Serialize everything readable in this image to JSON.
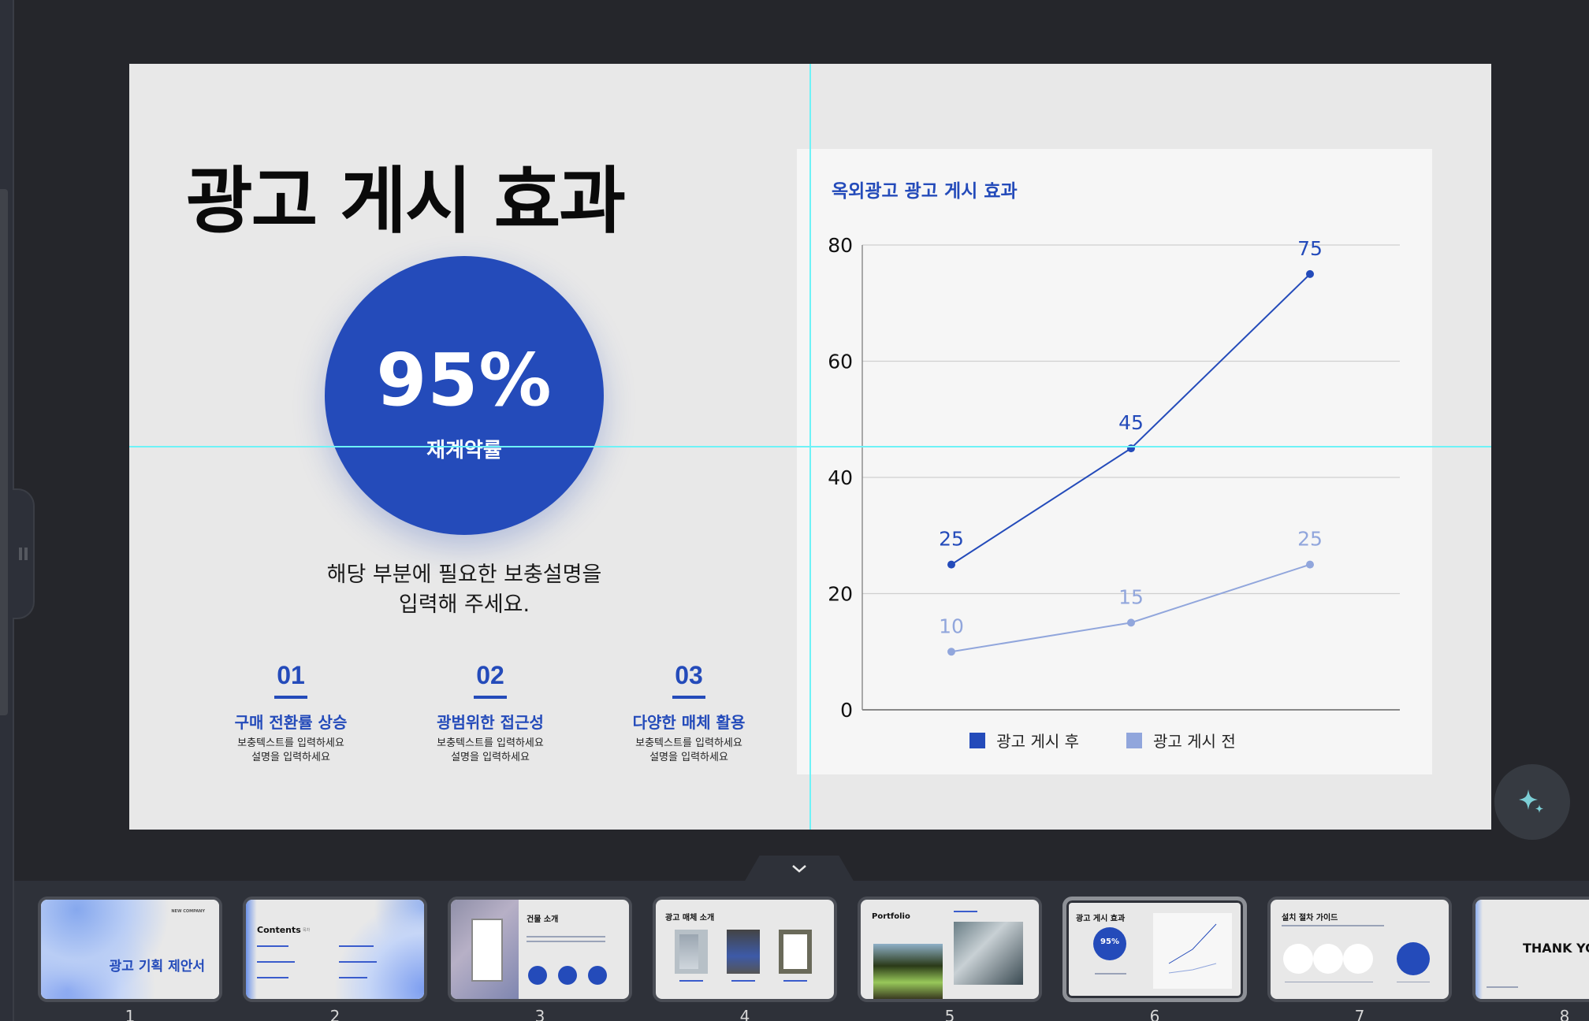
{
  "slide": {
    "title": "광고 게시 효과",
    "highlight": {
      "value": "95%",
      "label": "재계약률"
    },
    "description_lines": [
      "해당 부분에 필요한 보충설명을",
      "입력해 주세요."
    ],
    "features": [
      {
        "num": "01",
        "heading": "구매 전환률 상승",
        "sub_lines": [
          "보충텍스트를 입력하세요",
          "설명을 입력하세요"
        ]
      },
      {
        "num": "02",
        "heading": "광범위한 접근성",
        "sub_lines": [
          "보충텍스트를 입력하세요",
          "설명을 입력하세요"
        ]
      },
      {
        "num": "03",
        "heading": "다양한 매체 활용",
        "sub_lines": [
          "보충텍스트를 입력하세요",
          "설명을 입력하세요"
        ]
      }
    ]
  },
  "chart_data": {
    "type": "line",
    "title": "옥외광고 광고 게시 효과",
    "categories": [
      "",
      "",
      ""
    ],
    "xlabel": "",
    "ylabel": "",
    "ylim": [
      0,
      80
    ],
    "yticks": [
      0,
      20,
      40,
      60,
      80
    ],
    "grid": true,
    "legend_position": "bottom",
    "series": [
      {
        "name": "광고 게시 후",
        "color": "#244bba",
        "values": [
          25,
          45,
          75
        ]
      },
      {
        "name": "광고 게시 전",
        "color": "#91a6dc",
        "values": [
          10,
          15,
          25
        ]
      }
    ]
  },
  "colors": {
    "accent": "#244bba",
    "accent_light": "#91a6dc",
    "guide": "#6ef2f7",
    "fab_icon": "#7ccfd6"
  },
  "thumbnails": [
    {
      "num": "1",
      "title": "광고 기획 제안서",
      "caption": "NEW COMPANY"
    },
    {
      "num": "2",
      "title": "Contents",
      "caption": "목차"
    },
    {
      "num": "3",
      "title": "건물 소개",
      "caption": ""
    },
    {
      "num": "4",
      "title": "광고 매체 소개",
      "caption": ""
    },
    {
      "num": "5",
      "title": "Portfolio",
      "caption": ""
    },
    {
      "num": "6",
      "title": "광고 게시 효과",
      "caption": "95%",
      "selected": true
    },
    {
      "num": "7",
      "title": "설치 절차 가이드",
      "caption": ""
    },
    {
      "num": "8",
      "title": "THANK YOU",
      "caption": ""
    }
  ],
  "icons": {
    "fab": "sparkle-icon",
    "collapse": "chevron-down-icon",
    "panel_handle": "drag-handle-icon"
  }
}
